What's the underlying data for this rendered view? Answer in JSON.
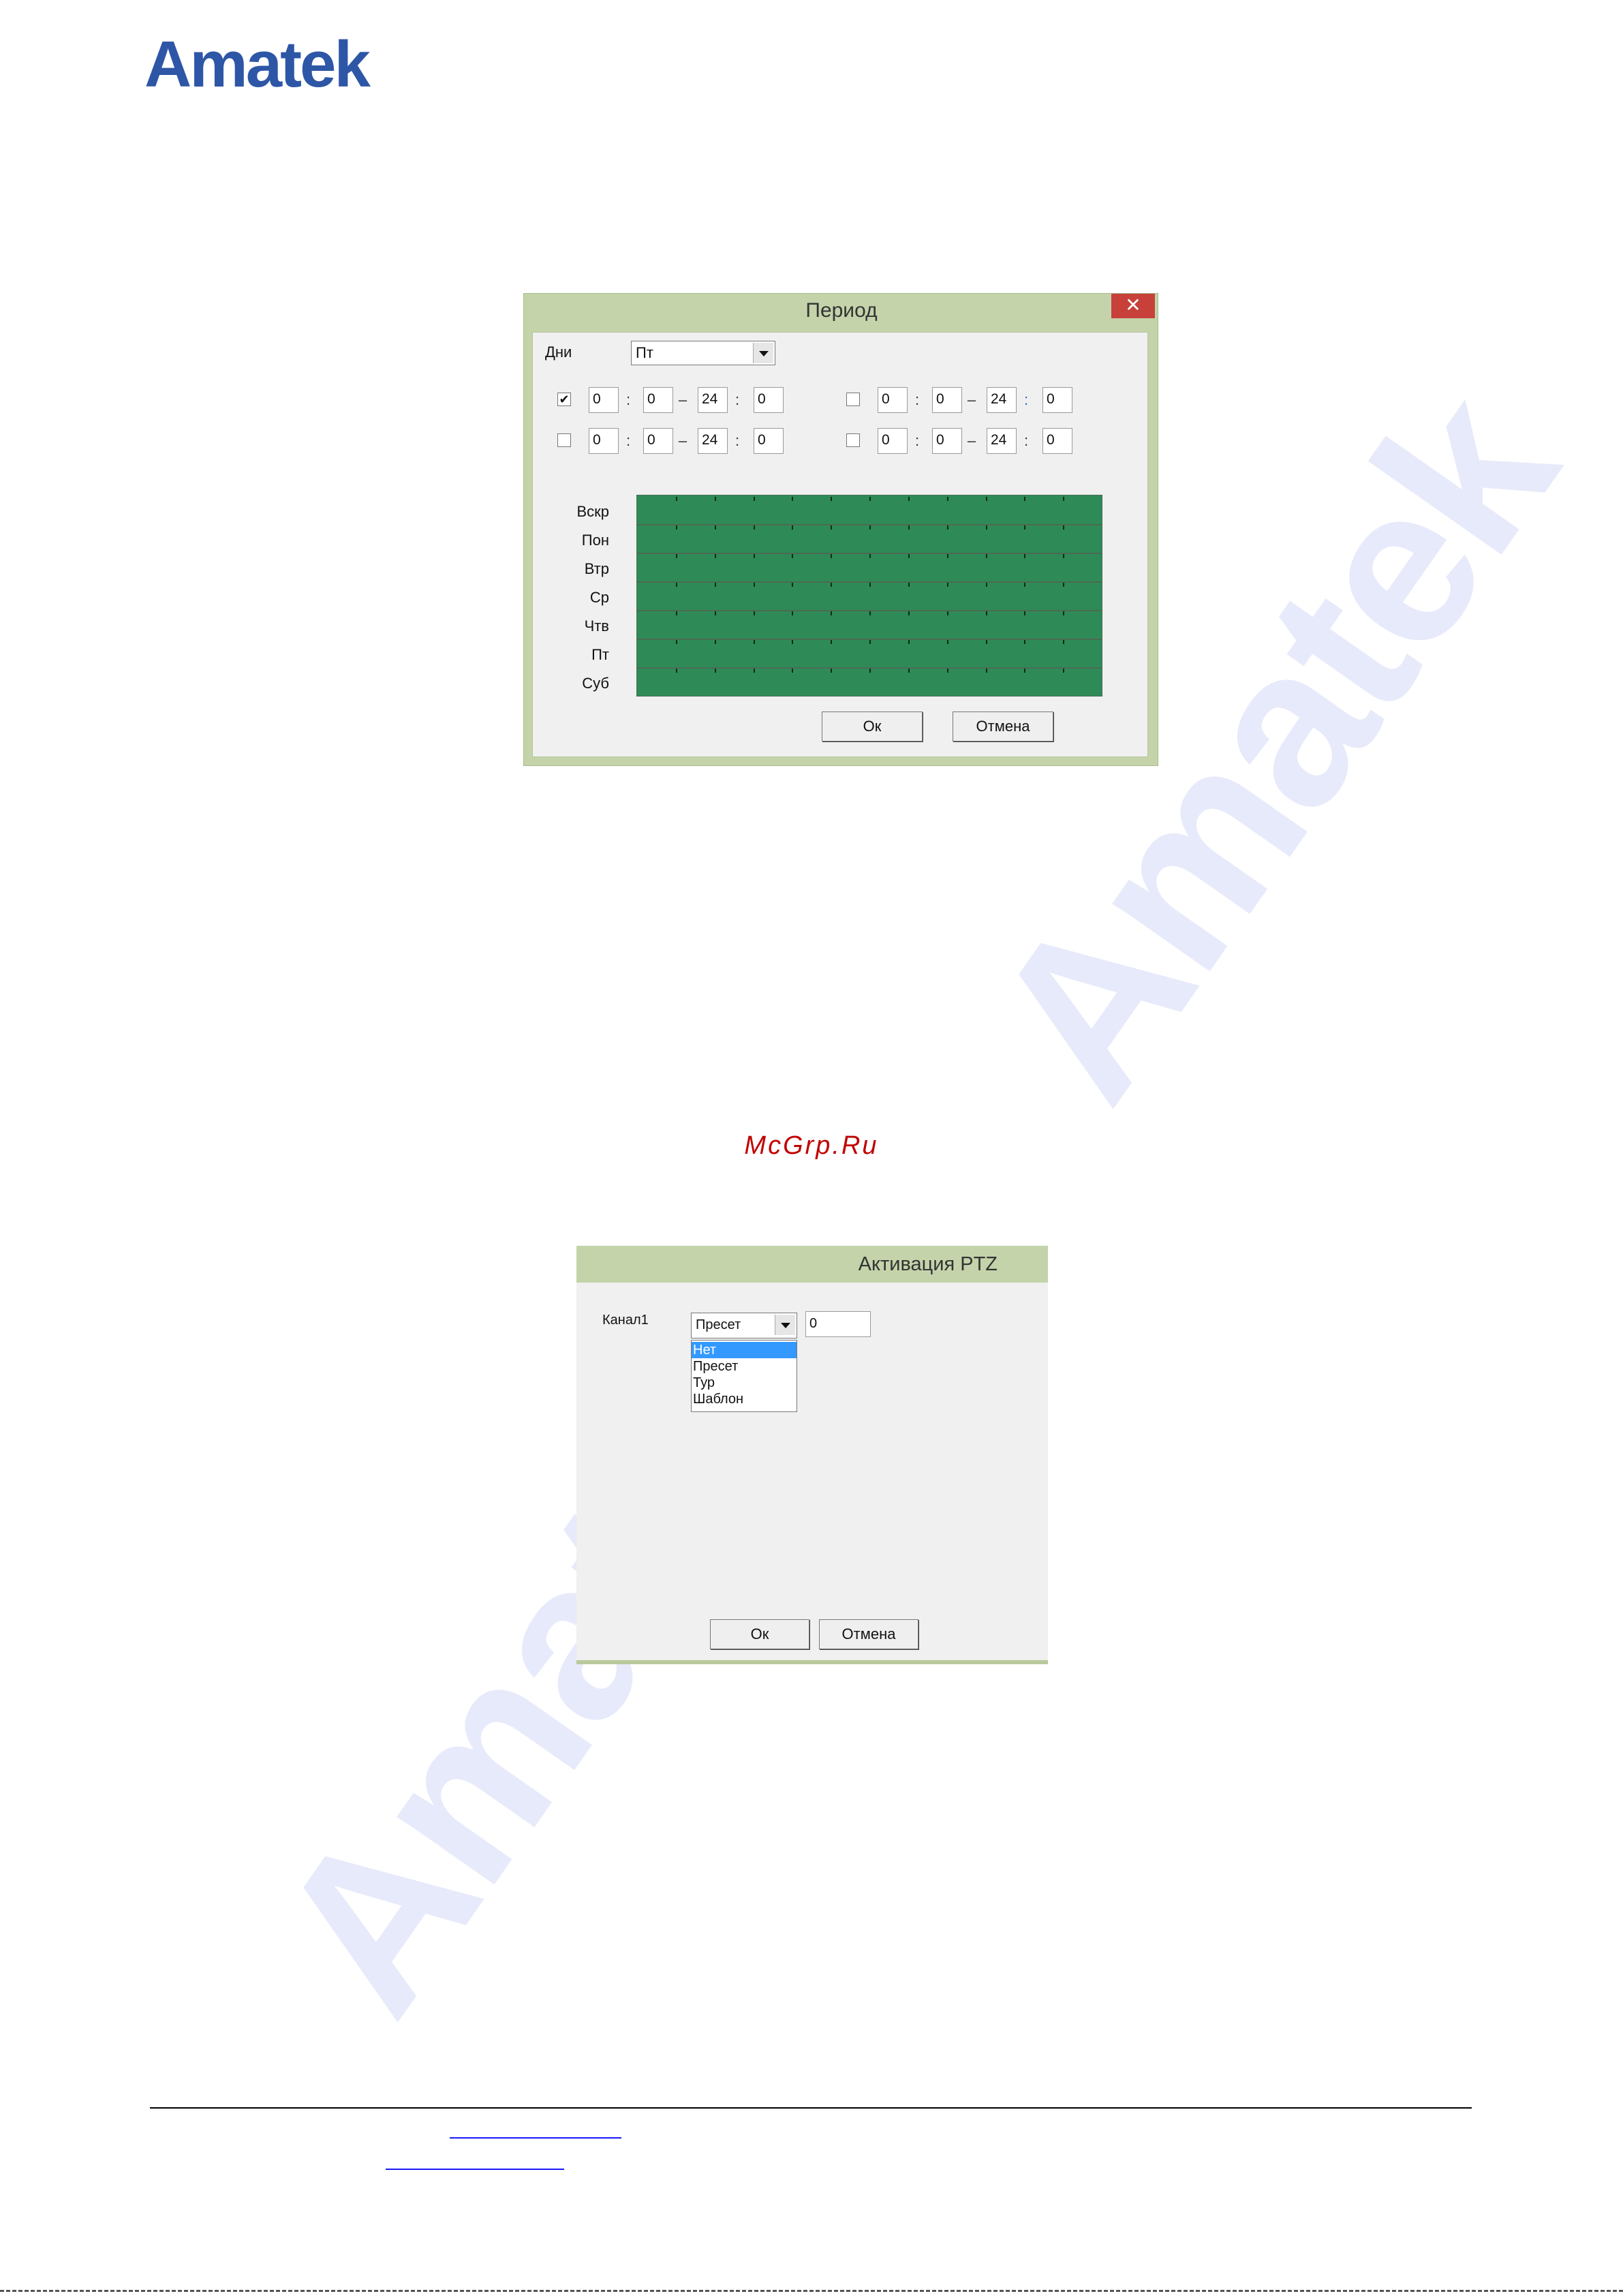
{
  "logo": "Amatek",
  "watermark": "Amatek",
  "site_mark": "McGrp.Ru",
  "period_dialog": {
    "title": "Период",
    "close": "✕",
    "days_label": "Дни",
    "days_value": "Пт",
    "ranges": [
      {
        "checked": "✔",
        "h1": "0",
        "m1": "0",
        "h2": "24",
        "m2": "0"
      },
      {
        "checked": "",
        "h1": "0",
        "m1": "0",
        "h2": "24",
        "m2": "0"
      },
      {
        "checked": "",
        "h1": "0",
        "m1": "0",
        "h2": "24",
        "m2": "0"
      },
      {
        "checked": "",
        "h1": "0",
        "m1": "0",
        "h2": "24",
        "m2": "0"
      }
    ],
    "sep_colon": ":",
    "sep_dash": "–",
    "days": [
      "Вскр",
      "Пон",
      "Втр",
      "Ср",
      "Чтв",
      "Пт",
      "Суб"
    ],
    "ok": "Ок",
    "cancel": "Отмена",
    "colors": {
      "grid": "#2e8b57",
      "frame": "#c4d3aa"
    }
  },
  "ptz_dialog": {
    "title": "Активация PTZ",
    "channel_label": "Канал1",
    "select_value": "Пресет",
    "number_value": "0",
    "options": [
      "Нет",
      "Пресет",
      "Тур",
      "Шаблон"
    ],
    "ok": "Ок",
    "cancel": "Отмена"
  }
}
